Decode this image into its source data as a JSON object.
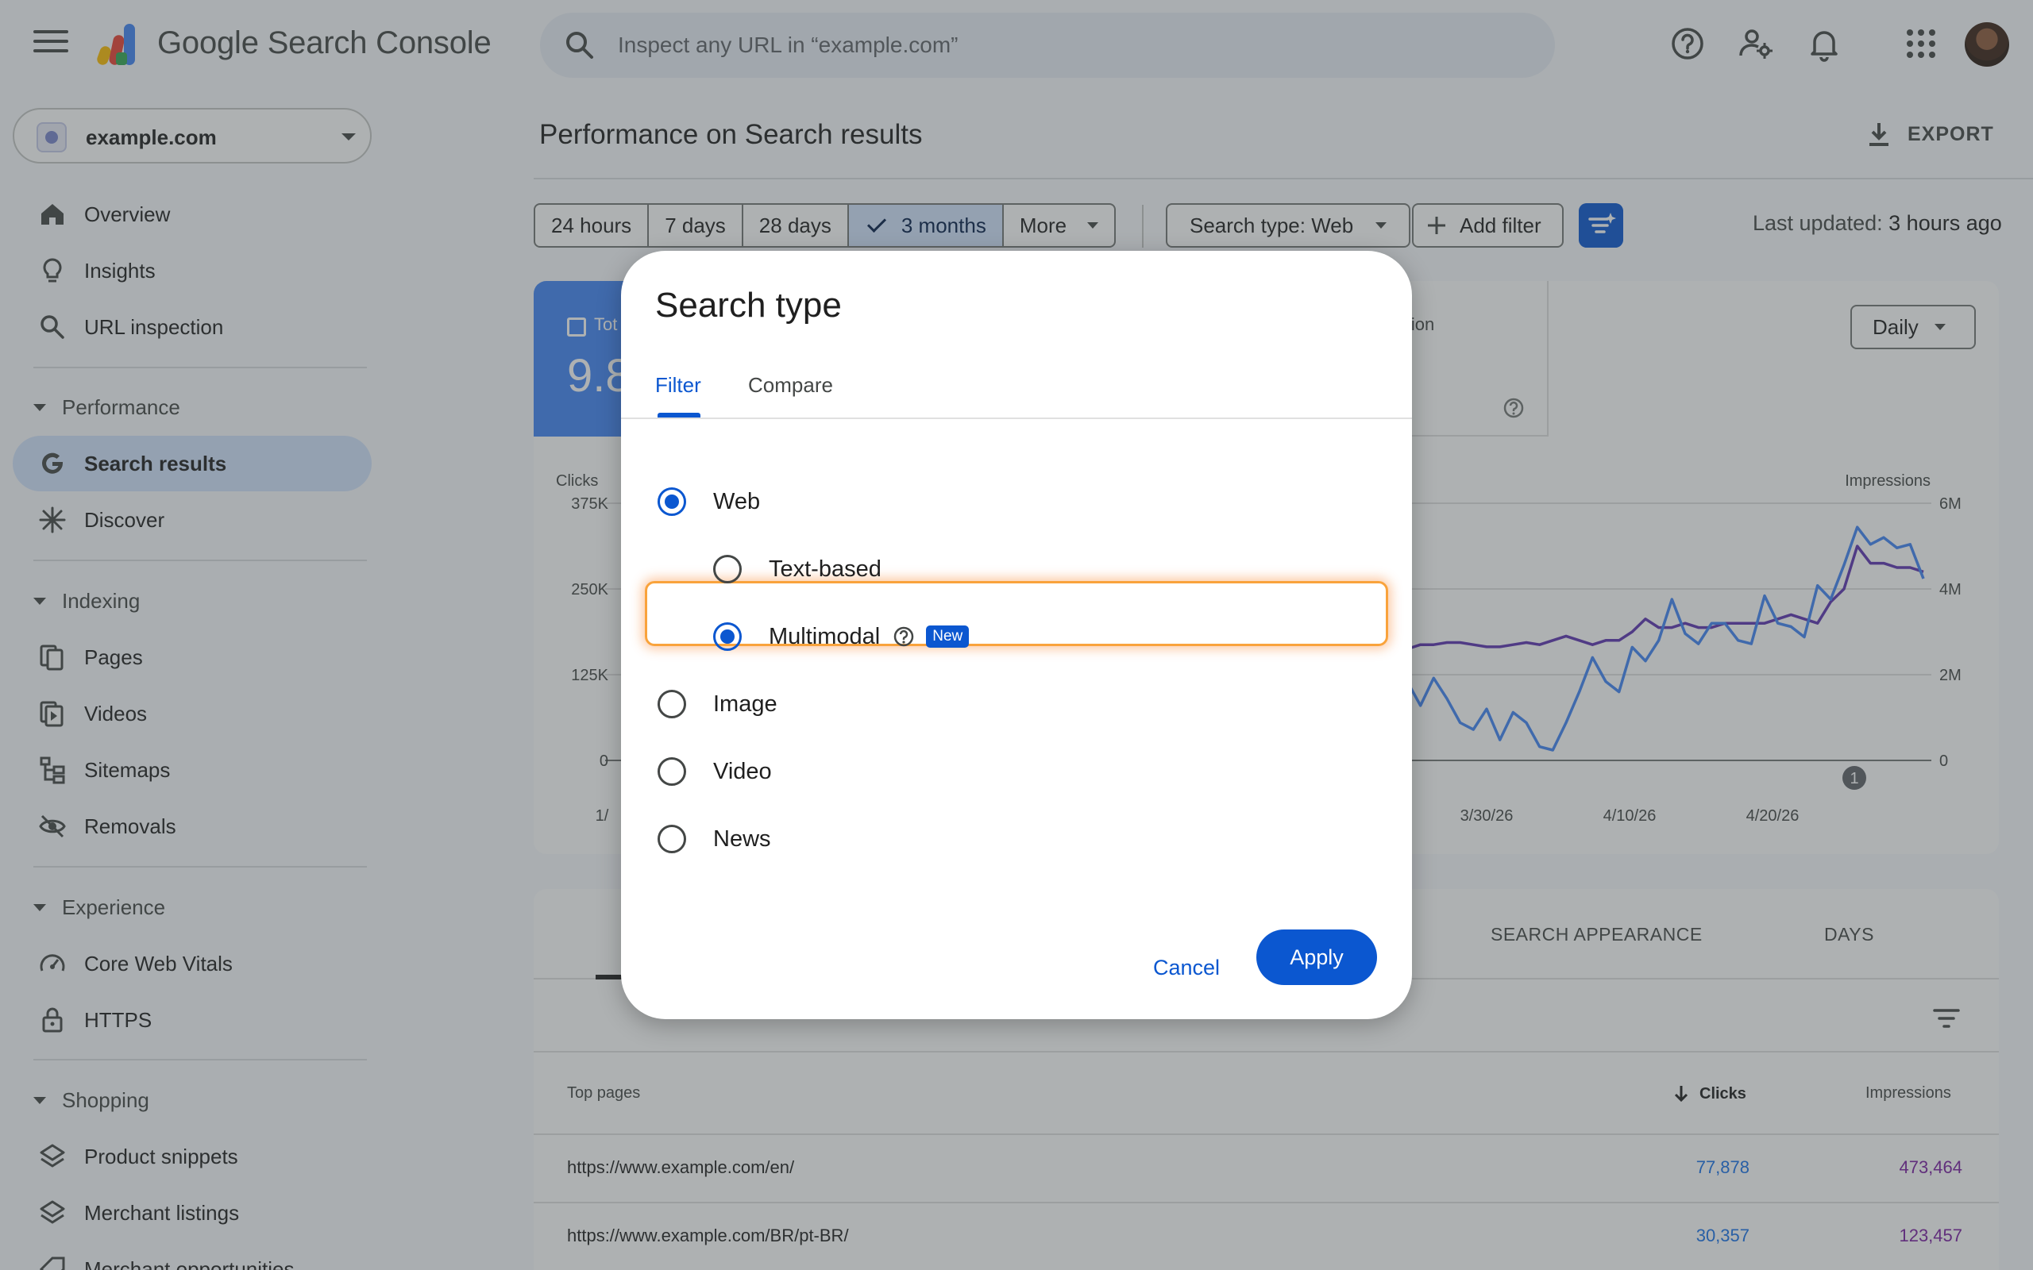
{
  "app": {
    "product_name": "Google Search Console",
    "search_placeholder": "Inspect any URL in “example.com”",
    "property": "example.com"
  },
  "sidebar": {
    "top_items": [
      {
        "label": "Overview",
        "icon": "home-icon"
      },
      {
        "label": "Insights",
        "icon": "lightbulb-icon"
      },
      {
        "label": "URL inspection",
        "icon": "search-icon"
      }
    ],
    "sections": [
      {
        "title": "Performance",
        "items": [
          {
            "label": "Search results",
            "icon": "google-g-icon",
            "active": true
          },
          {
            "label": "Discover",
            "icon": "asterisk-icon"
          }
        ]
      },
      {
        "title": "Indexing",
        "items": [
          {
            "label": "Pages",
            "icon": "pages-icon"
          },
          {
            "label": "Videos",
            "icon": "video-icon"
          },
          {
            "label": "Sitemaps",
            "icon": "sitemap-icon"
          },
          {
            "label": "Removals",
            "icon": "eye-off-icon"
          }
        ]
      },
      {
        "title": "Experience",
        "items": [
          {
            "label": "Core Web Vitals",
            "icon": "gauge-icon"
          },
          {
            "label": "HTTPS",
            "icon": "lock-icon"
          }
        ]
      },
      {
        "title": "Shopping",
        "items": [
          {
            "label": "Product snippets",
            "icon": "layers-icon"
          },
          {
            "label": "Merchant listings",
            "icon": "layers-icon"
          },
          {
            "label": "Merchant opportunities",
            "icon": "tag-icon"
          }
        ]
      }
    ]
  },
  "main": {
    "title": "Performance on Search results",
    "export_label": "EXPORT",
    "ranges": [
      "24 hours",
      "7 days",
      "28 days",
      "3 months",
      "More"
    ],
    "selected_range": "3 months",
    "search_type_chip": "Search type: Web",
    "add_filter": "Add filter",
    "last_updated_prefix": "Last updated:",
    "last_updated_value": "3 hours ago",
    "metric_clicks_title": "Tot",
    "metric_clicks_value": "9.8",
    "metric_position_title": "e position",
    "granularity": "Daily",
    "tabs": [
      "SEARCH APPEARANCE",
      "DAYS"
    ],
    "table": {
      "col_page": "Top pages",
      "col_clicks": "Clicks",
      "col_impressions": "Impressions",
      "rows": [
        {
          "url": "https://www.example.com/en/",
          "clicks": "77,878",
          "impressions": "473,464"
        },
        {
          "url": "https://www.example.com/BR/pt-BR/",
          "clicks": "30,357",
          "impressions": "123,457"
        }
      ]
    }
  },
  "chart_data": {
    "type": "line",
    "left_axis_label": "Clicks",
    "right_axis_label": "Impressions",
    "left_ticks": [
      "375K",
      "250K",
      "125K",
      "0"
    ],
    "right_ticks": [
      "6M",
      "4M",
      "2M",
      "0"
    ],
    "x_ticks": [
      "1/",
      "3/30/26",
      "4/10/26",
      "4/20/26"
    ],
    "annotation": "1",
    "colors": {
      "clicks": "#4285f4",
      "impressions": "#5e35b1"
    },
    "visible_x_range_note_free": true,
    "series": [
      {
        "name": "Clicks",
        "values": [
          115000,
          80000,
          120000,
          90000,
          55000,
          45000,
          75000,
          30000,
          70000,
          55000,
          20000,
          15000,
          55000,
          100000,
          150000,
          115000,
          100000,
          165000,
          145000,
          175000,
          235000,
          185000,
          170000,
          200000,
          200000,
          175000,
          170000,
          240000,
          200000,
          195000,
          180000,
          255000,
          235000,
          285000,
          340000,
          315000,
          325000,
          310000,
          315000,
          265000
        ]
      },
      {
        "name": "Impressions",
        "values": [
          2600000,
          2700000,
          2700000,
          2750000,
          2750000,
          2700000,
          2650000,
          2650000,
          2700000,
          2750000,
          2700000,
          2800000,
          2900000,
          2800000,
          2700000,
          2800000,
          2800000,
          3000000,
          3300000,
          3100000,
          3100000,
          3200000,
          3100000,
          3100000,
          3200000,
          3200000,
          3200000,
          3200000,
          3300000,
          3400000,
          3300000,
          3200000,
          3700000,
          4000000,
          5000000,
          4600000,
          4600000,
          4500000,
          4500000,
          4400000
        ]
      }
    ]
  },
  "dialog": {
    "title": "Search type",
    "tab_filter": "Filter",
    "tab_compare": "Compare",
    "options": {
      "web": "Web",
      "text_based": "Text-based",
      "multimodal": "Multimodal",
      "image": "Image",
      "video": "Video",
      "news": "News"
    },
    "new_badge": "New",
    "cancel": "Cancel",
    "apply": "Apply"
  }
}
